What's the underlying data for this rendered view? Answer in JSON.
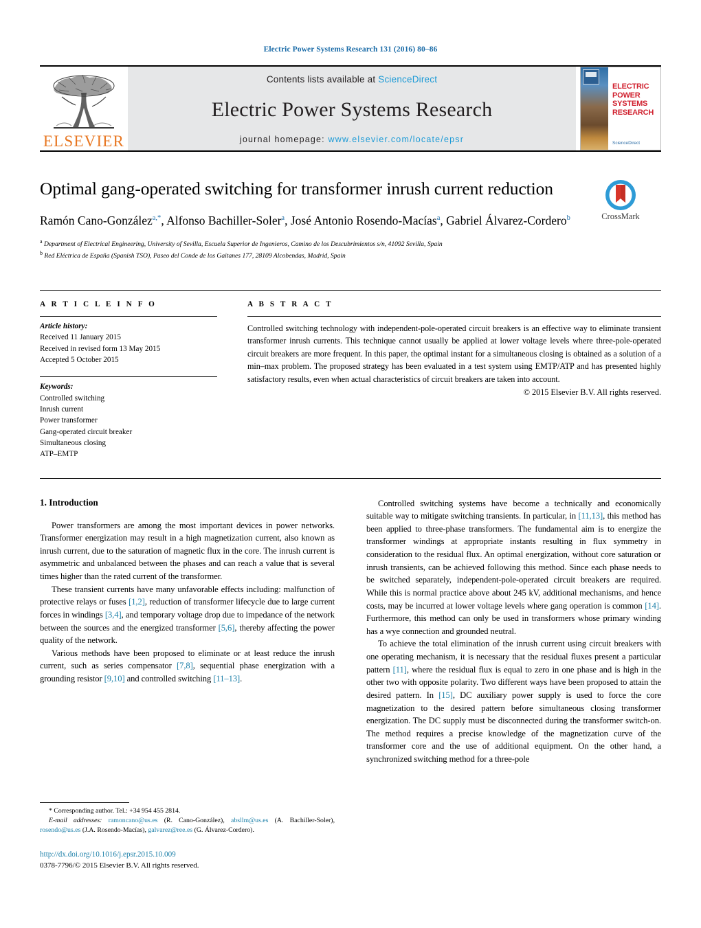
{
  "running_head": "Electric Power Systems Research 131 (2016) 80–86",
  "masthead": {
    "publisher_name": "ELSEVIER",
    "contents_prefix": "Contents lists available at ",
    "contents_link": "ScienceDirect",
    "journal_title": "Electric Power Systems Research",
    "homepage_prefix": "journal homepage: ",
    "homepage_url": "www.elsevier.com/locate/epsr",
    "cover": {
      "title_line1": "ELECTRIC POWER",
      "title_line2": "SYSTEMS RESEARCH",
      "footer": "ScienceDirect"
    }
  },
  "article": {
    "title": "Optimal gang-operated switching for transformer inrush current reduction",
    "authors_html": "Ramón Cano-González<sup>a,*</sup>, Alfonso Bachiller-Soler<sup>a</sup>, José Antonio Rosendo-Macías<sup>a</sup>, Gabriel Álvarez-Cordero<sup>b</sup>",
    "affiliation_a": "Department of Electrical Engineering, University of Sevilla, Escuela Superior de Ingenieros, Camino de los Descubrimientos s/n, 41092 Sevilla, Spain",
    "affiliation_b": "Red Eléctrica de España (Spanish TSO), Paseo del Conde de los Gaitanes 177, 28109 Alcobendas, Madrid, Spain",
    "crossmark_label": "CrossMark"
  },
  "info": {
    "heading": "A R T I C L E    I N F O",
    "history_label": "Article history:",
    "history": [
      "Received 11 January 2015",
      "Received in revised form 13 May 2015",
      "Accepted 5 October 2015"
    ],
    "keywords_label": "Keywords:",
    "keywords": [
      "Controlled switching",
      "Inrush current",
      "Power transformer",
      "Gang-operated circuit breaker",
      "Simultaneous closing",
      "ATP–EMTP"
    ]
  },
  "abstract": {
    "heading": "A B S T R A C T",
    "text": "Controlled switching technology with independent-pole-operated circuit breakers is an effective way to eliminate transient transformer inrush currents. This technique cannot usually be applied at lower voltage levels where three-pole-operated circuit breakers are more frequent. In this paper, the optimal instant for a simultaneous closing is obtained as a solution of a min–max problem. The proposed strategy has been evaluated in a test system using EMTP/ATP and has presented highly satisfactory results, even when actual characteristics of circuit breakers are taken into account.",
    "copyright": "© 2015 Elsevier B.V. All rights reserved."
  },
  "body": {
    "section_title": "1.  Introduction",
    "left_paragraphs": [
      "Power transformers are among the most important devices in power networks. Transformer energization may result in a high magnetization current, also known as inrush current, due to the saturation of magnetic flux in the core. The inrush current is asymmetric and unbalanced between the phases and can reach a value that is several times higher than the rated current of the transformer.",
      "These transient currents have many unfavorable effects including: malfunction of protective relays or fuses [1,2], reduction of transformer lifecycle due to large current forces in windings [3,4], and temporary voltage drop due to impedance of the network between the sources and the energized transformer [5,6], thereby affecting the power quality of the network.",
      "Various methods have been proposed to eliminate or at least reduce the inrush current, such as series compensator [7,8], sequential phase energization with a grounding resistor [9,10] and controlled switching [11–13]."
    ],
    "right_paragraphs": [
      "Controlled switching systems have become a technically and economically suitable way to mitigate switching transients. In particular, in [11,13], this method has been applied to three-phase transformers. The fundamental aim is to energize the transformer windings at appropriate instants resulting in flux symmetry in consideration to the residual flux. An optimal energization, without core saturation or inrush transients, can be achieved following this method. Since each phase needs to be switched separately, independent-pole-operated circuit breakers are required. While this is normal practice above about 245 kV, additional mechanisms, and hence costs, may be incurred at lower voltage levels where gang operation is common [14]. Furthermore, this method can only be used in transformers whose primary winding has a wye connection and grounded neutral.",
      "To achieve the total elimination of the inrush current using circuit breakers with one operating mechanism, it is necessary that the residual fluxes present a particular pattern [11], where the residual flux is equal to zero in one phase and is high in the other two with opposite polarity. Two different ways have been proposed to attain the desired pattern. In [15], DC auxiliary power supply is used to force the core magnetization to the desired pattern before simultaneous closing transformer energization. The DC supply must be disconnected during the transformer switch-on. The method requires a precise knowledge of the magnetization curve of the transformer core and the use of additional equipment. On the other hand, a synchronized switching method for a three-pole"
    ]
  },
  "footnotes": {
    "corresponding": "* Corresponding author. Tel.: +34 954 455 2814.",
    "email_label": "E-mail addresses:",
    "emails": [
      {
        "address": "ramoncano@us.es",
        "owner": "(R. Cano-González)"
      },
      {
        "address": "absllm@us.es",
        "owner": "(A. Bachiller-Soler)"
      },
      {
        "address": "rosendo@us.es",
        "owner": "(J.A. Rosendo-Macías)"
      },
      {
        "address": "galvarez@ree.es",
        "owner": "(G. Álvarez-Cordero)"
      }
    ],
    "doi": "http://dx.doi.org/10.1016/j.epsr.2015.10.009",
    "issn_line": "0378-7796/© 2015 Elsevier B.V. All rights reserved."
  },
  "colors": {
    "link_blue": "#1b7fa8",
    "sciencedirect_blue": "#1b9ad6",
    "elsevier_orange": "#e87722",
    "cover_red": "#d0202e",
    "masthead_grey": "#e6e7e8"
  }
}
